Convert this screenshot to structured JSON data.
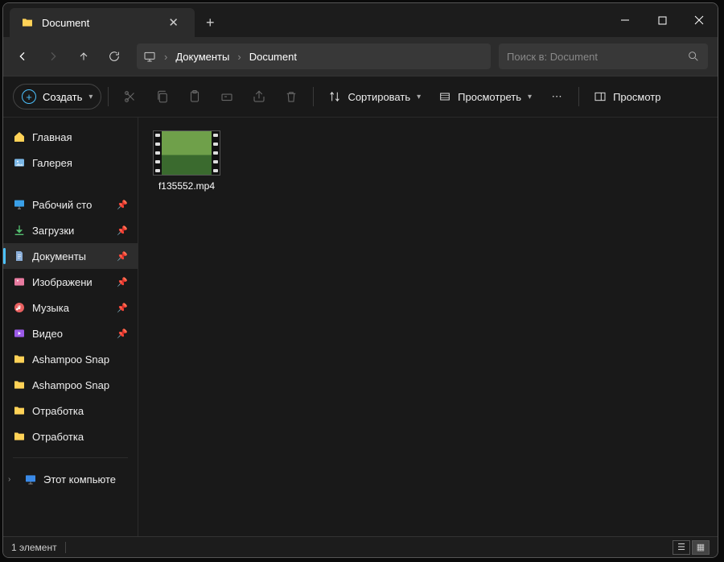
{
  "title": "Document",
  "breadcrumb": {
    "item1": "Документы",
    "item2": "Document"
  },
  "search": {
    "placeholder": "Поиск в: Document"
  },
  "toolbar": {
    "create": "Создать",
    "sort": "Сортировать",
    "view": "Просмотреть",
    "preview": "Просмотр"
  },
  "sidebar": {
    "home": "Главная",
    "gallery": "Галерея",
    "desktop": "Рабочий сто",
    "downloads": "Загрузки",
    "documents": "Документы",
    "pictures": "Изображени",
    "music": "Музыка",
    "video": "Видео",
    "snap1": "Ashampoo Snap",
    "snap2": "Ashampoo Snap",
    "work1": "Отработка",
    "work2": "Отработка",
    "thispc": "Этот компьюте"
  },
  "files": [
    {
      "name": "f135552.mp4"
    }
  ],
  "status": {
    "count": "1 элемент"
  }
}
